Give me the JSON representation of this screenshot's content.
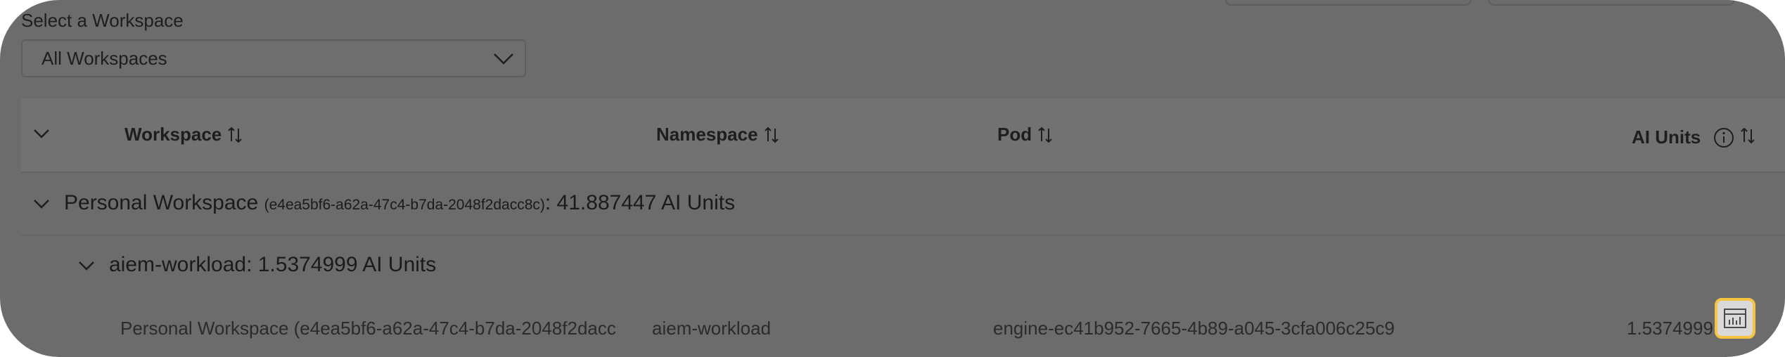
{
  "header": {
    "select_label": "Select a Workspace",
    "select_value": "All Workspaces"
  },
  "table": {
    "columns": {
      "workspace": "Workspace",
      "namespace": "Namespace",
      "pod": "Pod",
      "ai_units": "AI Units"
    },
    "group": {
      "name": "Personal Workspace",
      "id": "(e4ea5bf6-a62a-47c4-b7da-2048f2dacc8c)",
      "total": ": 41.887447 AI Units"
    },
    "subgroup": {
      "label": "aiem-workload: 1.5374999 AI Units"
    },
    "rows": [
      {
        "workspace": "Personal Workspace (e4ea5bf6-a62a-47c4-b7da-2048f2dacc",
        "namespace": "aiem-workload",
        "pod": "engine-ec41b952-7665-4b89-a045-3cfa006c25c9",
        "ai_units": "1.5374999"
      }
    ]
  },
  "icons": {
    "chevron": "chevron-down-icon",
    "sort": "sort-icon",
    "info": "info-icon",
    "report": "report-icon"
  },
  "colors": {
    "overlay": "#6c6c6c",
    "highlight": "#f5c542"
  }
}
